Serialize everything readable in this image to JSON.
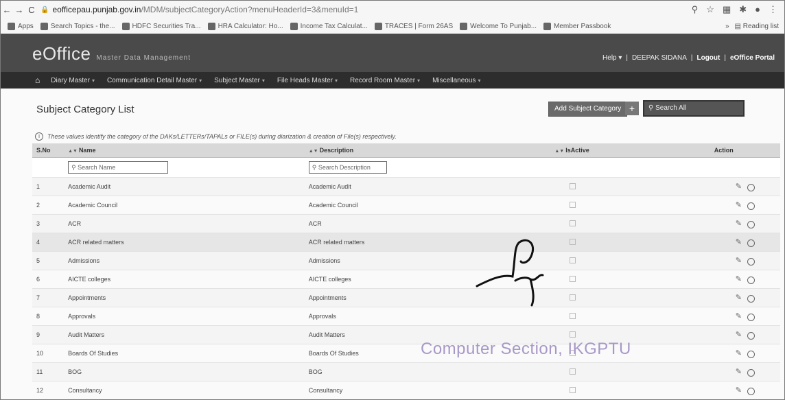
{
  "browser": {
    "url_host": "eofficepau.punjab.gov.in",
    "url_path": "/MDM/subjectCategoryAction?menuHeaderId=3&menuId=1",
    "bookmarks": [
      {
        "label": "Apps"
      },
      {
        "label": "Search Topics - the..."
      },
      {
        "label": "HDFC Securities Tra..."
      },
      {
        "label": "HRA Calculator: Ho..."
      },
      {
        "label": "Income Tax Calculat..."
      },
      {
        "label": "TRACES | Form 26AS"
      },
      {
        "label": "Welcome To Punjab..."
      },
      {
        "label": "Member Passbook"
      }
    ],
    "more_label": "»",
    "reading_list": "Reading list"
  },
  "header": {
    "logo": "eOffice",
    "subtitle": "Master Data Management",
    "help": "Help",
    "user": "DEEPAK SIDANA",
    "logout": "Logout",
    "portal": "eOffice Portal"
  },
  "menu": [
    {
      "label": "Diary Master"
    },
    {
      "label": "Communication Detail Master"
    },
    {
      "label": "Subject Master"
    },
    {
      "label": "File Heads Master"
    },
    {
      "label": "Record Room Master"
    },
    {
      "label": "Miscellaneous"
    }
  ],
  "page": {
    "title": "Subject Category  List",
    "add_button": "Add Subject Category",
    "plus": "+",
    "search_all_placeholder": "Search All",
    "info": "These values identify the category of the DAKs/LETTERs/TAPALs or FILE(s) during diarization & creation of File(s) respectively."
  },
  "table": {
    "headers": {
      "sno": "S.No",
      "name": "Name",
      "description": "Description",
      "isactive": "IsActive",
      "action": "Action"
    },
    "search_name": "Search Name",
    "search_desc": "Search Description",
    "rows": [
      {
        "sno": "1",
        "name": "Academic Audit",
        "description": "Academic Audit"
      },
      {
        "sno": "2",
        "name": "Academic Council",
        "description": "Academic Council"
      },
      {
        "sno": "3",
        "name": "ACR",
        "description": "ACR"
      },
      {
        "sno": "4",
        "name": "ACR related matters",
        "description": "ACR related matters"
      },
      {
        "sno": "5",
        "name": "Admissions",
        "description": "Admissions"
      },
      {
        "sno": "6",
        "name": "AICTE colleges",
        "description": "AICTE colleges"
      },
      {
        "sno": "7",
        "name": "Appointments",
        "description": "Appointments"
      },
      {
        "sno": "8",
        "name": "Approvals",
        "description": "Approvals"
      },
      {
        "sno": "9",
        "name": "Audit Matters",
        "description": "Audit Matters"
      },
      {
        "sno": "10",
        "name": "Boards Of Studies",
        "description": "Boards Of Studies"
      },
      {
        "sno": "11",
        "name": "BOG",
        "description": "BOG"
      },
      {
        "sno": "12",
        "name": "Consultancy",
        "description": "Consultancy"
      }
    ]
  },
  "overlay": {
    "stamp": "Computer Section, IKGPTU"
  }
}
